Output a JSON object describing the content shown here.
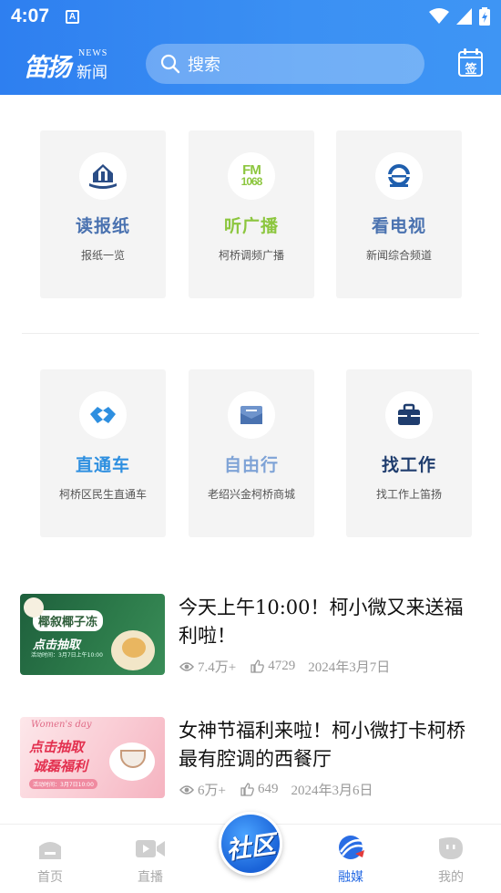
{
  "status_bar": {
    "time": "4:07",
    "notification_letter": "A"
  },
  "header": {
    "logo_text": "笛扬",
    "logo_news": "NEWS",
    "logo_news_cn": "新闻",
    "search_placeholder": "搜索",
    "sign_label": "签"
  },
  "tiles": [
    {
      "title": "读报纸",
      "subtitle": "报纸一览",
      "color": "#4a72b0",
      "icon": "newspaper-icon"
    },
    {
      "title": "听广播",
      "subtitle": "柯桥调频广播",
      "color": "#8cc63e",
      "icon": "fm-radio-icon",
      "icon_text": "FM",
      "icon_text2": "1068"
    },
    {
      "title": "看电视",
      "subtitle": "新闻综合频道",
      "color": "#4a72b0",
      "icon": "tv-icon"
    },
    {
      "title": "直通车",
      "subtitle": "柯桥区民生直通车",
      "color": "#2e8fe0",
      "icon": "handshake-icon"
    },
    {
      "title": "自由行",
      "subtitle": "老绍兴金柯桥商城",
      "color": "#7fa3d6",
      "icon": "mail-icon"
    },
    {
      "title": "找工作",
      "subtitle": "找工作上笛扬",
      "color": "#2a4d86",
      "icon": "briefcase-icon"
    }
  ],
  "articles": [
    {
      "title": "今天上午10:00！柯小微又来送福利啦！",
      "views": "7.4万+",
      "likes": "4729",
      "date": "2024年3月7日",
      "thumb_text": "椰叙椰子冻",
      "thumb_sub": "点击抽取",
      "thumb_small": "活动时间：3月7日上午10:00"
    },
    {
      "title": "女神节福利来啦！柯小微打卡柯桥最有腔调的西餐厅",
      "views": "6万+",
      "likes": "649",
      "date": "2024年3月6日",
      "thumb_text": "点击抽取",
      "thumb_sub": "诚磊福利",
      "thumb_small": "活动时间：3月7日10:00",
      "thumb_script": "Women's day"
    }
  ],
  "bottom_nav": [
    {
      "label": "首页",
      "icon": "home-icon",
      "active": false
    },
    {
      "label": "直播",
      "icon": "video-camera-icon",
      "active": false
    },
    {
      "label": "融媒",
      "icon": "rongmei-icon",
      "active": true
    },
    {
      "label": "我的",
      "icon": "profile-icon",
      "active": false
    }
  ],
  "community_label": "社区",
  "colors": {
    "header": "#3b8ef3",
    "accent": "#2a6de4",
    "tile_bg": "#f4f4f4"
  }
}
